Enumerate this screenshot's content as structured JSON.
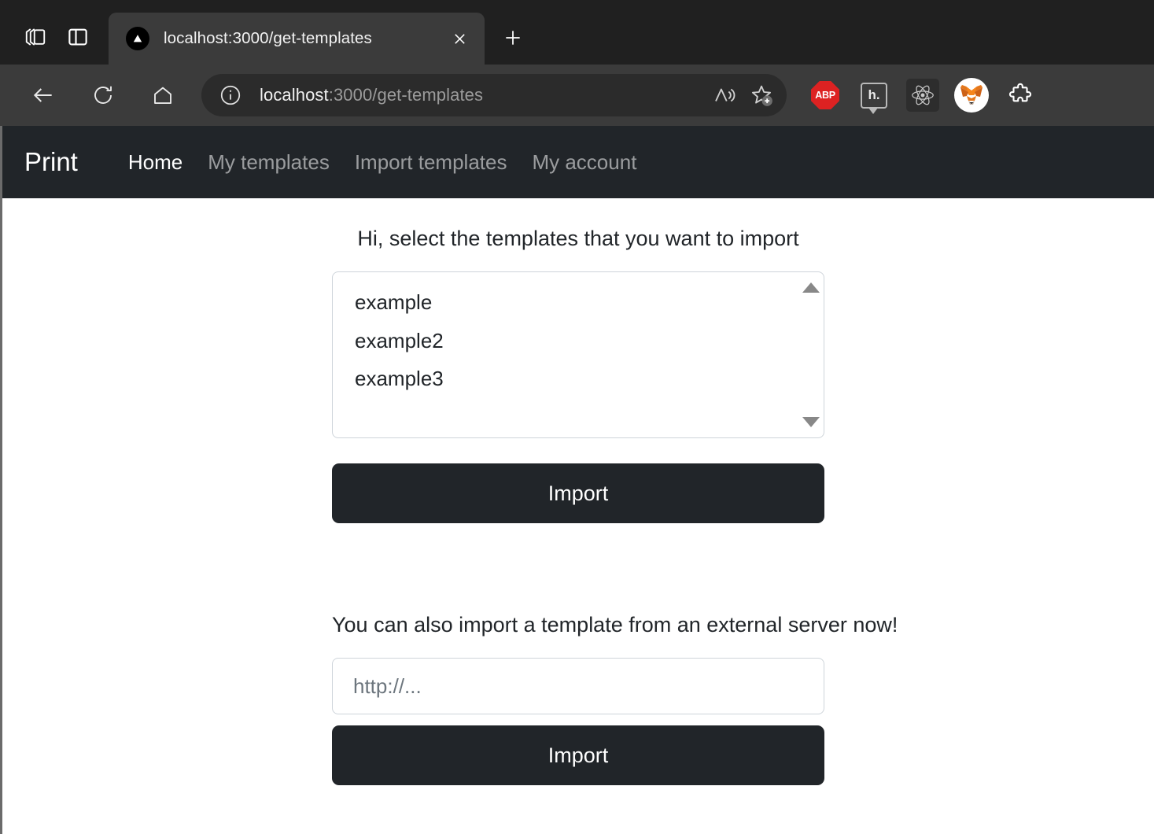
{
  "browser": {
    "tab_actions_icon": "tab-actions-icon",
    "split_screen_icon": "split-screen-icon",
    "tab": {
      "favicon": "nextjs-triangle-favicon",
      "title": "localhost:3000/get-templates",
      "close_icon": "close-icon"
    },
    "new_tab_icon": "plus-icon",
    "toolbar": {
      "back_icon": "back-arrow-icon",
      "refresh_icon": "refresh-icon",
      "home_icon": "home-icon",
      "site_info_icon": "info-circle-icon",
      "url_host": "localhost",
      "url_rest": ":3000/get-templates",
      "read_aloud_icon": "read-aloud-icon",
      "add_favorite_icon": "star-add-icon",
      "extensions": [
        {
          "name": "adblock-plus-extension-icon",
          "label": "ABP"
        },
        {
          "name": "hypothesis-extension-icon",
          "label": "h."
        },
        {
          "name": "react-devtools-extension-icon",
          "label": ""
        },
        {
          "name": "metamask-extension-icon",
          "label": ""
        },
        {
          "name": "extensions-puzzle-icon",
          "label": ""
        }
      ]
    }
  },
  "page": {
    "navbar": {
      "brand": "Print",
      "links": [
        {
          "label": "Home",
          "active": true
        },
        {
          "label": "My templates",
          "active": false
        },
        {
          "label": "Import templates",
          "active": false
        },
        {
          "label": "My account",
          "active": false
        }
      ]
    },
    "import_section": {
      "heading": "Hi, select the templates that you want to import",
      "templates": [
        "example",
        "example2",
        "example3"
      ],
      "scroll_up_icon": "scroll-up-arrow-icon",
      "scroll_down_icon": "scroll-down-arrow-icon",
      "import_button": "Import"
    },
    "external_section": {
      "heading": "You can also import a template from an external server now!",
      "url_placeholder": "http://...",
      "url_value": "",
      "import_button": "Import"
    }
  },
  "colors": {
    "navbar_bg": "#212529",
    "button_bg": "#212529",
    "page_bg": "#ffffff",
    "border": "#ced4da",
    "muted_link": "rgba(255,255,255,0.55)",
    "chrome_tabstrip": "#202020",
    "chrome_toolbar": "#3b3b3b"
  }
}
